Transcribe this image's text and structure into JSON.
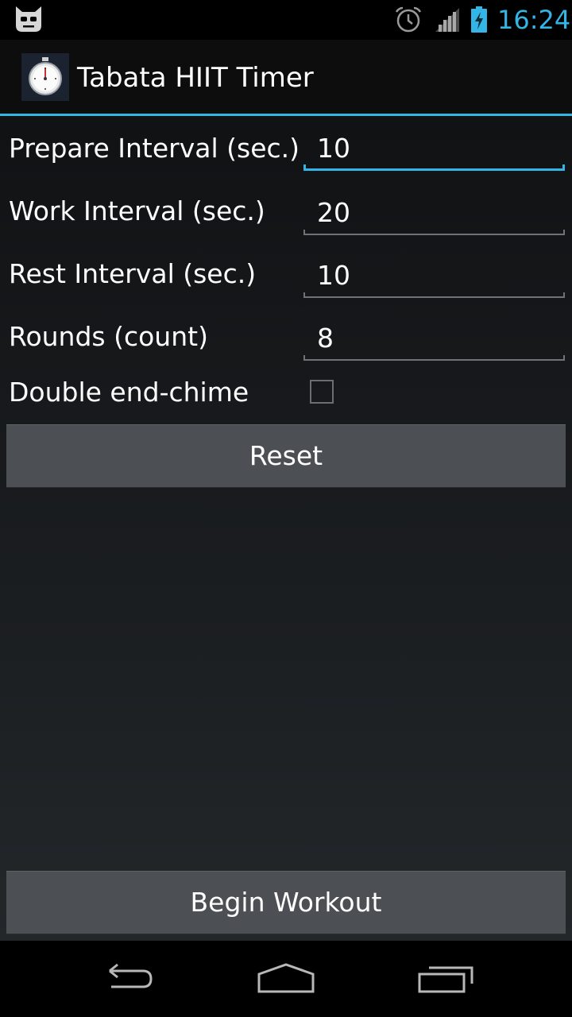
{
  "status_bar": {
    "time": "16:24",
    "icons": [
      "cyanogenmod-notification-icon",
      "alarm-icon",
      "signal-icon",
      "battery-charging-icon"
    ],
    "accent_color": "#33b5e5"
  },
  "action_bar": {
    "app_icon": "stopwatch-icon",
    "title": "Tabata HIIT Timer"
  },
  "settings": {
    "prepare": {
      "label": "Prepare Interval (sec.)",
      "value": "10"
    },
    "work": {
      "label": "Work Interval (sec.)",
      "value": "20"
    },
    "rest": {
      "label": "Rest Interval (sec.)",
      "value": "10"
    },
    "rounds": {
      "label": "Rounds (count)",
      "value": "8"
    },
    "double_chime": {
      "label": "Double end-chime",
      "checked": false
    }
  },
  "buttons": {
    "reset": "Reset",
    "begin": "Begin Workout"
  },
  "nav_bar": {
    "icons": [
      "back-icon",
      "home-icon",
      "recent-apps-icon"
    ]
  }
}
